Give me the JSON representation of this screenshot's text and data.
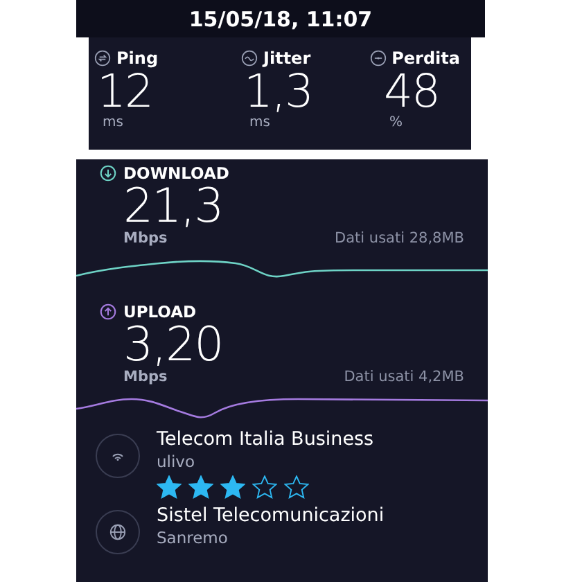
{
  "header": {
    "datetime": "15/05/18, 11:07"
  },
  "metrics": [
    {
      "kind": "ping",
      "label": "Ping",
      "value": "12",
      "unit": "ms"
    },
    {
      "kind": "jitter",
      "label": "Jitter",
      "value": "1,3",
      "unit": "ms"
    },
    {
      "kind": "loss",
      "label": "Perdita",
      "value": "48",
      "unit": "%"
    }
  ],
  "speeds": [
    {
      "kind": "download",
      "label": "DOWNLOAD",
      "value": "21,3",
      "unit": "Mbps",
      "data_used": "Dati usati 28,8MB"
    },
    {
      "kind": "upload",
      "label": "UPLOAD",
      "value": "3,20",
      "unit": "Mbps",
      "data_used": "Dati usati 4,2MB"
    }
  ],
  "providers": [
    {
      "kind": "wifi",
      "name": "Telecom Italia Business",
      "detail": "ulivo",
      "stars": 3
    },
    {
      "kind": "globe",
      "name": "Sistel Telecomunicazioni",
      "detail": "Sanremo"
    }
  ]
}
